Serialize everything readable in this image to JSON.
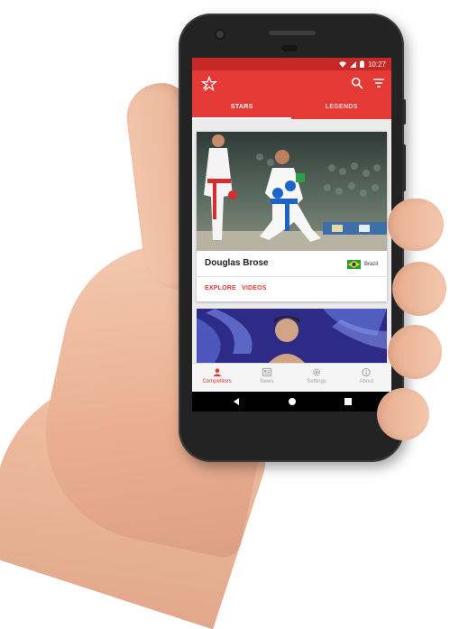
{
  "status_bar": {
    "time": "10:27"
  },
  "app_bar": {
    "logo_icon": "star-logo-icon",
    "search_icon": "search-icon",
    "filter_icon": "filter-icon"
  },
  "tabs": [
    {
      "label": "STARS",
      "active": true
    },
    {
      "label": "LEGENDS",
      "active": false
    }
  ],
  "cards": [
    {
      "name": "Douglas Brose",
      "country": "Brazil",
      "actions": [
        "EXPLORE",
        "VIDEOS"
      ]
    }
  ],
  "bottom_nav": [
    {
      "label": "Competitors",
      "icon": "person-icon",
      "active": true
    },
    {
      "label": "News",
      "icon": "news-icon",
      "active": false
    },
    {
      "label": "Settings",
      "icon": "gear-icon",
      "active": false
    },
    {
      "label": "About",
      "icon": "info-icon",
      "active": false
    }
  ],
  "colors": {
    "primary": "#e53935",
    "status_bar": "#c62828",
    "card2_bg": "#2d2b85"
  }
}
